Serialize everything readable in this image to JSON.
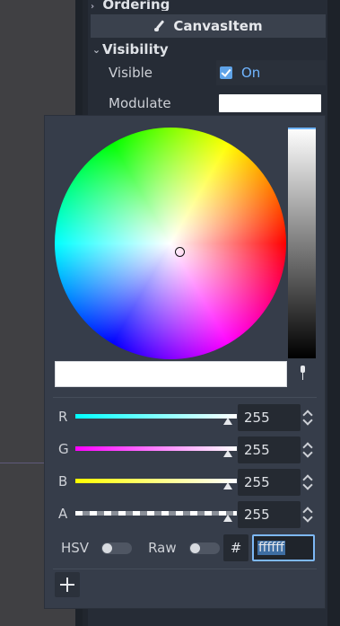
{
  "inspector": {
    "ordering_label": "Ordering",
    "section_title": "CanvasItem",
    "visibility_label": "Visibility",
    "visible": {
      "label": "Visible",
      "value": "On",
      "checked": true
    },
    "modulate": {
      "label": "Modulate",
      "color": "#ffffff"
    }
  },
  "color_picker": {
    "current_color": "#ffffff",
    "channels": [
      {
        "name": "R",
        "value": "255"
      },
      {
        "name": "G",
        "value": "255"
      },
      {
        "name": "B",
        "value": "255"
      },
      {
        "name": "A",
        "value": "255"
      }
    ],
    "hsv_label": "HSV",
    "raw_label": "Raw",
    "hash_label": "#",
    "hex_value": "ffffff"
  },
  "icons": {
    "brush": "brush-icon",
    "eyedropper": "eyedropper-icon",
    "add": "plus-icon"
  }
}
